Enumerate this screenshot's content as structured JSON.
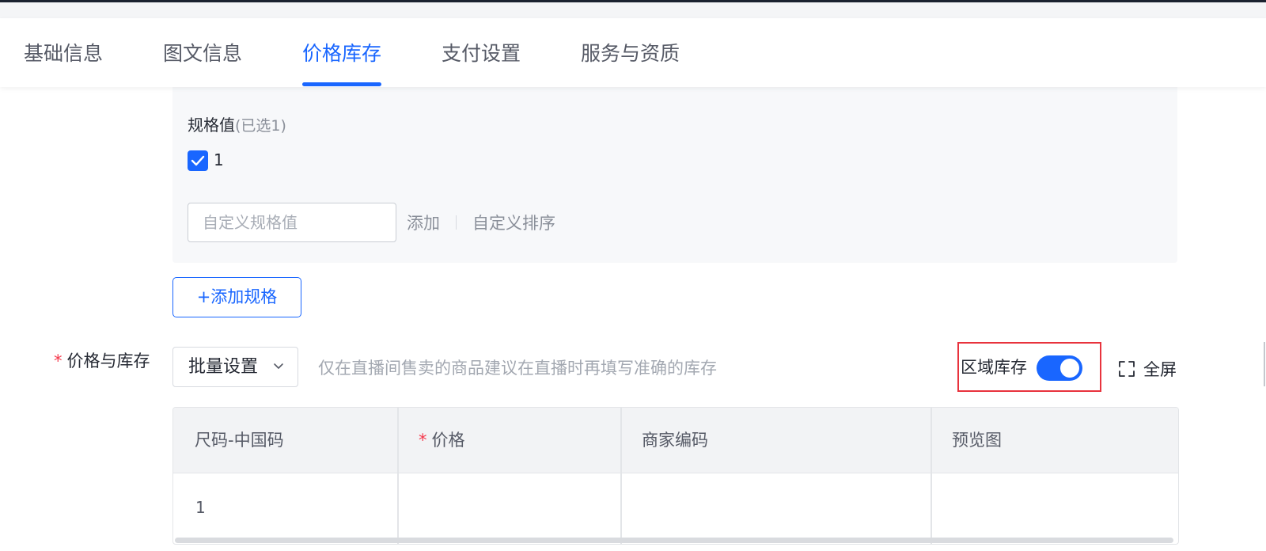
{
  "tabs": [
    {
      "label": "基础信息",
      "active": false
    },
    {
      "label": "图文信息",
      "active": false
    },
    {
      "label": "价格库存",
      "active": true
    },
    {
      "label": "支付设置",
      "active": false
    },
    {
      "label": "服务与资质",
      "active": false
    }
  ],
  "spec": {
    "title": "规格值",
    "selected_note": "(已选1)",
    "checkbox_label": "1",
    "checkbox_checked": true,
    "input_placeholder": "自定义规格值",
    "add_label": "添加",
    "sort_label": "自定义排序"
  },
  "add_spec_button": "+添加规格",
  "price_stock": {
    "required_mark": "*",
    "label": "价格与库存",
    "batch_select_value": "批量设置",
    "hint": "仅在直播间售卖的商品建议在直播时再填写准确的库存",
    "region_stock_label": "区域库存",
    "region_stock_on": true,
    "fullscreen_label": "全屏"
  },
  "table": {
    "headers": [
      {
        "label": "尺码-中国码",
        "required": false
      },
      {
        "label": "价格",
        "required": true,
        "required_mark": "*"
      },
      {
        "label": "商家编码",
        "required": false
      },
      {
        "label": "预览图",
        "required": false
      }
    ],
    "rows": [
      [
        "1",
        "",
        "",
        ""
      ]
    ]
  },
  "colors": {
    "accent": "#1966ff",
    "required": "#f5384b",
    "highlight": "#e8333d"
  },
  "icons": [
    "check-icon",
    "chevron-down-icon",
    "fullscreen-icon"
  ]
}
